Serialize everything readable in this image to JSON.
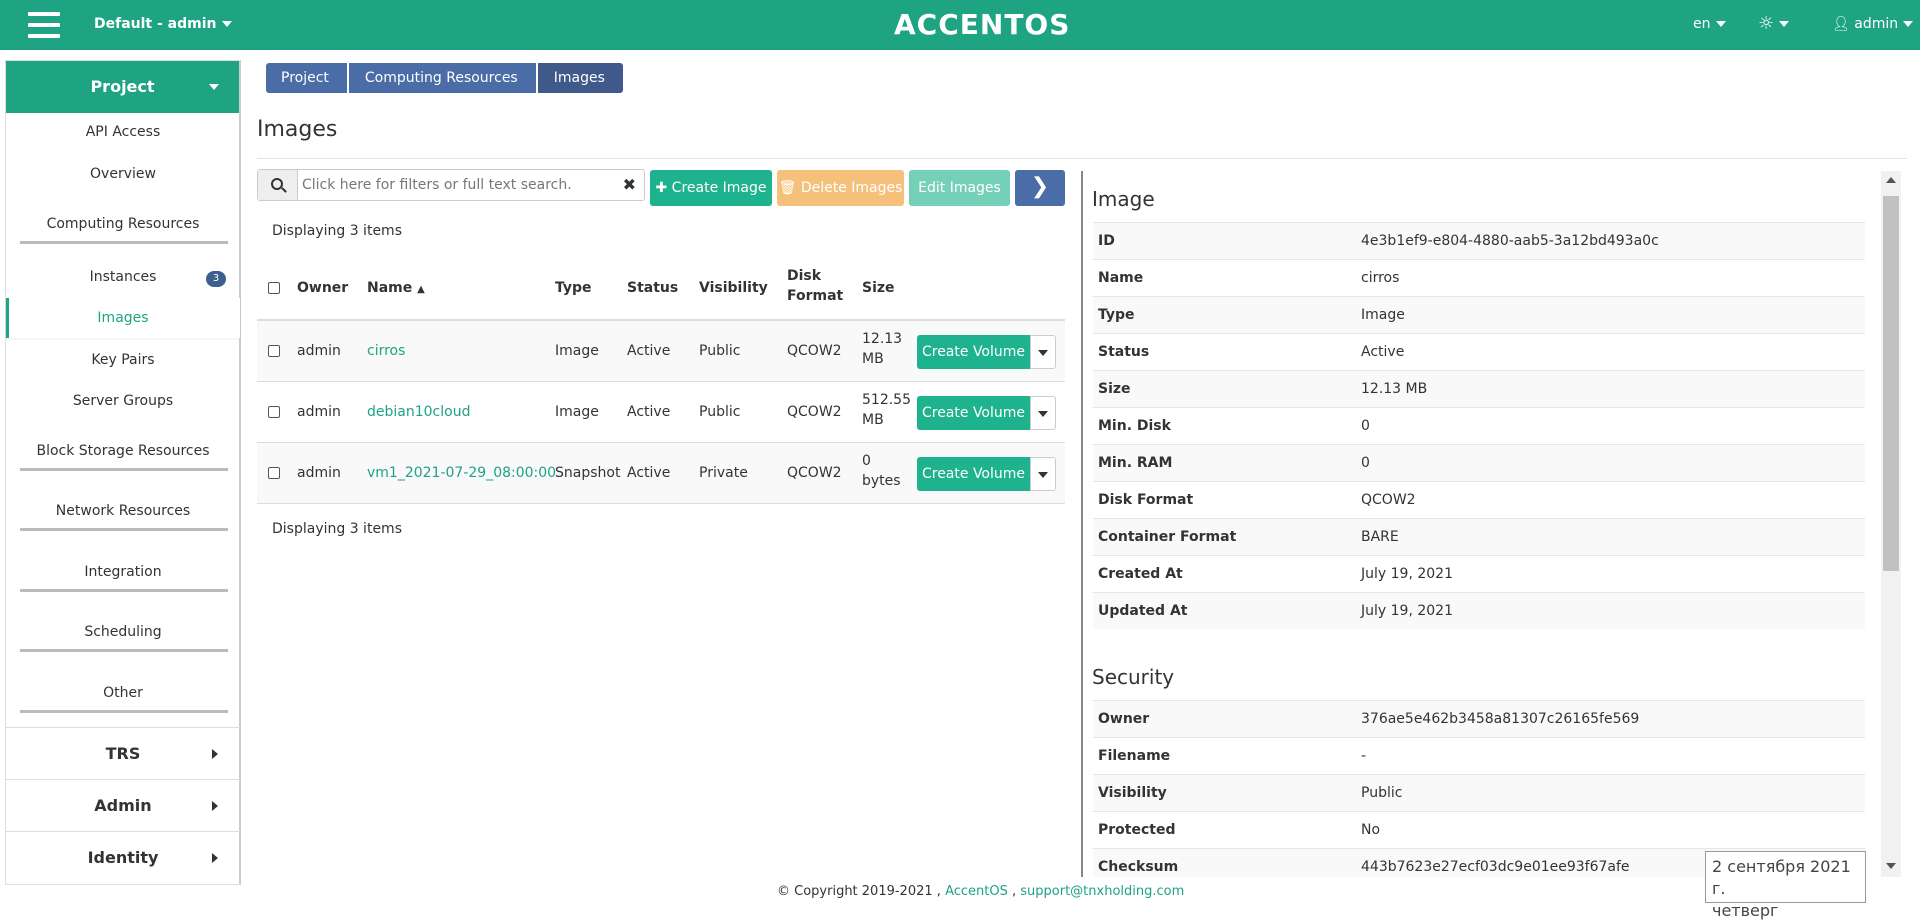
{
  "topbar": {
    "domain": "Default - admin",
    "logo": "ACCENTOS",
    "lang": "en",
    "user": "admin"
  },
  "sidebar": {
    "project": "Project",
    "api_access": "API Access",
    "overview": "Overview",
    "computing": "Computing Resources",
    "instances": "Instances",
    "instances_count": "3",
    "images": "Images",
    "key_pairs": "Key Pairs",
    "server_groups": "Server Groups",
    "block_storage": "Block Storage Resources",
    "network": "Network Resources",
    "integration": "Integration",
    "scheduling": "Scheduling",
    "other": "Other",
    "trs": "TRS",
    "admin": "Admin",
    "identity": "Identity"
  },
  "breadcrumb": [
    "Project",
    "Computing Resources",
    "Images"
  ],
  "page_title": "Images",
  "toolbar": {
    "search_placeholder": "Click here for filters or full text search.",
    "create": "Create Image",
    "delete": "Delete Images",
    "edit": "Edit Images"
  },
  "displaying": "Displaying 3 items",
  "table": {
    "headers": {
      "owner": "Owner",
      "name": "Name",
      "type": "Type",
      "status": "Status",
      "visibility": "Visibility",
      "disk_format_1": "Disk",
      "disk_format_2": "Format",
      "size": "Size"
    },
    "rows": [
      {
        "owner": "admin",
        "name": "cirros",
        "type": "Image",
        "status": "Active",
        "visibility": "Public",
        "format": "QCOW2",
        "size_1": "12.13",
        "size_2": "MB",
        "action": "Create Volume"
      },
      {
        "owner": "admin",
        "name": "debian10cloud",
        "type": "Image",
        "status": "Active",
        "visibility": "Public",
        "format": "QCOW2",
        "size_1": "512.55",
        "size_2": "MB",
        "action": "Create Volume"
      },
      {
        "owner": "admin",
        "name": "vm1_2021-07-29_08:00:00",
        "type": "Snapshot",
        "status": "Active",
        "visibility": "Private",
        "format": "QCOW2",
        "size_1": "0",
        "size_2": "bytes",
        "action": "Create Volume"
      }
    ]
  },
  "detail": {
    "image_heading": "Image",
    "image": [
      {
        "k": "ID",
        "v": "4e3b1ef9-e804-4880-aab5-3a12bd493a0c"
      },
      {
        "k": "Name",
        "v": "cirros"
      },
      {
        "k": "Type",
        "v": "Image"
      },
      {
        "k": "Status",
        "v": "Active"
      },
      {
        "k": "Size",
        "v": "12.13 MB"
      },
      {
        "k": "Min. Disk",
        "v": "0"
      },
      {
        "k": "Min. RAM",
        "v": "0"
      },
      {
        "k": "Disk Format",
        "v": "QCOW2"
      },
      {
        "k": "Container Format",
        "v": "BARE"
      },
      {
        "k": "Created At",
        "v": "July 19, 2021"
      },
      {
        "k": "Updated At",
        "v": "July 19, 2021"
      }
    ],
    "security_heading": "Security",
    "security": [
      {
        "k": "Owner",
        "v": "376ae5e462b3458a81307c26165fe569"
      },
      {
        "k": "Filename",
        "v": "-"
      },
      {
        "k": "Visibility",
        "v": "Public"
      },
      {
        "k": "Protected",
        "v": "No"
      },
      {
        "k": "Checksum",
        "v": "443b7623e27ecf03dc9e01ee93f67afe"
      }
    ]
  },
  "footer": {
    "copyright": "© Copyright 2019-2021 ,",
    "brand": "AccentOS",
    "sep": ",",
    "email": "support@tnxholding.com"
  },
  "date_overlay": {
    "line1": "2 сентября 2021 г.",
    "line2": "четверг"
  },
  "colors": {
    "accent": "#1ea383",
    "primary": "#4a6da7",
    "warning": "#f5c17a"
  }
}
